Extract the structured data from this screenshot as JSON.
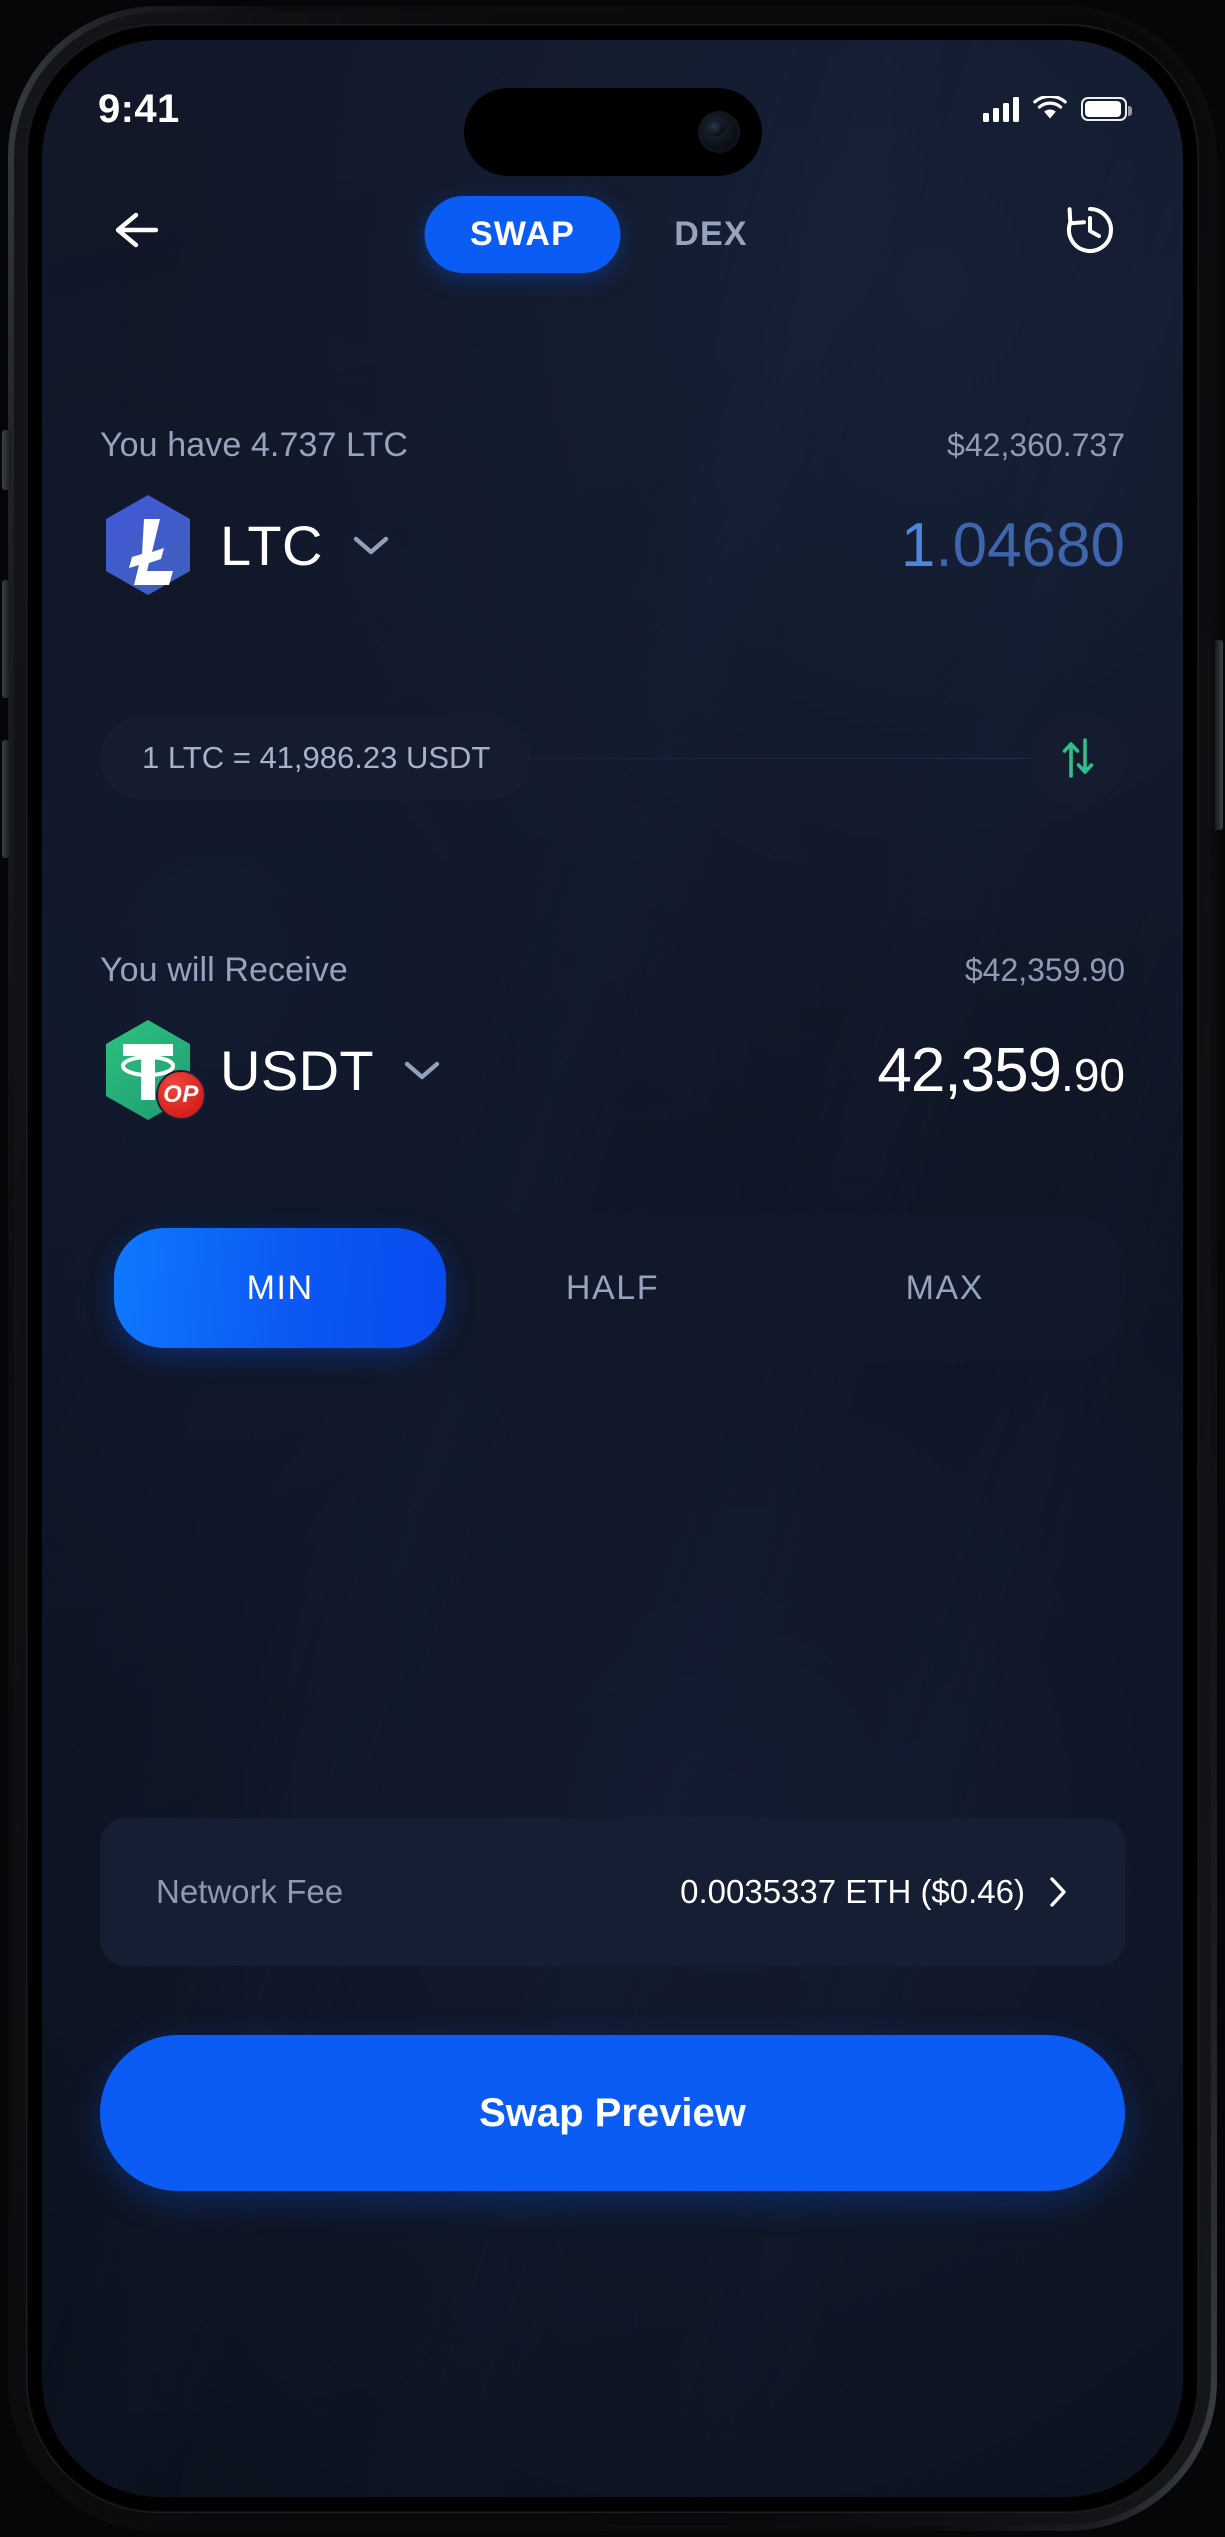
{
  "status_bar": {
    "time": "9:41",
    "cellular_icon": "signal-bars-icon",
    "wifi_icon": "wifi-icon",
    "battery_icon": "battery-icon"
  },
  "top_nav": {
    "back_icon": "back-arrow-icon",
    "history_icon": "history-clock-icon",
    "tabs": [
      {
        "label": "SWAP",
        "active": true
      },
      {
        "label": "DEX",
        "active": false
      }
    ]
  },
  "from_section": {
    "balance_label": "You have 4.737 LTC",
    "fiat_value": "$42,360.737",
    "token_symbol": "LTC",
    "token_icon": "litecoin-icon",
    "chevron_icon": "chevron-down-icon",
    "amount_int": "1",
    "amount_dec": ".04680"
  },
  "rate_row": {
    "rate_text": "1 LTC = 41,986.23 USDT",
    "swap_icon": "swap-vertical-arrows-icon"
  },
  "to_section": {
    "receive_label": "You will Receive",
    "fiat_value": "$42,359.90",
    "token_symbol": "USDT",
    "token_icon": "tether-icon",
    "network_badge": "OP",
    "chevron_icon": "chevron-down-icon",
    "amount_int": "42,359",
    "amount_dec": ".90"
  },
  "percent_selector": {
    "options": [
      {
        "label": "MIN",
        "active": true
      },
      {
        "label": "HALF",
        "active": false
      },
      {
        "label": "MAX",
        "active": false
      }
    ]
  },
  "network_fee": {
    "label": "Network Fee",
    "value": "0.0035337 ETH ($0.46)",
    "chevron_icon": "chevron-right-icon"
  },
  "cta": {
    "label": "Swap Preview"
  },
  "colors": {
    "accent_blue": "#0b5cf5",
    "screen_bg": "#0f1524",
    "muted_text": "#97a3bd",
    "litecoin_blue": "#3f57c9",
    "tether_green": "#22b07a",
    "op_red": "#d4211c"
  }
}
